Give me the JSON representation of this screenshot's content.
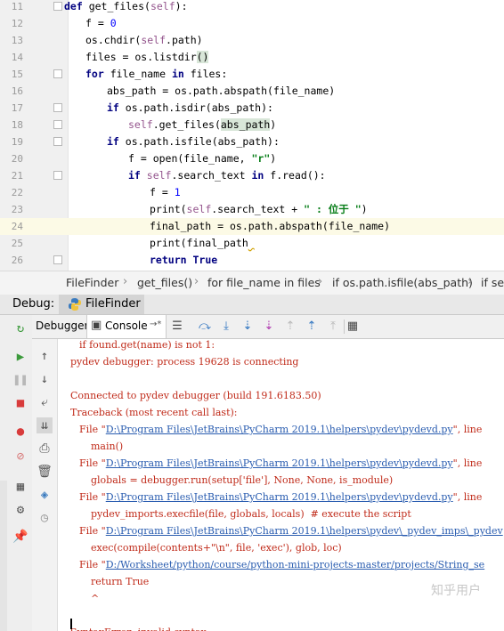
{
  "editor": {
    "lines": [
      {
        "n": "11",
        "indent": 0,
        "segs": [
          {
            "t": "def ",
            "c": "kw"
          },
          {
            "t": "get_files(",
            "c": ""
          },
          {
            "t": "self",
            "c": "sf"
          },
          {
            "t": "):",
            "c": ""
          }
        ],
        "fold": true,
        "clip": true
      },
      {
        "n": "12",
        "indent": 1,
        "segs": [
          {
            "t": "f = ",
            "c": ""
          },
          {
            "t": "0",
            "c": "nm"
          }
        ]
      },
      {
        "n": "13",
        "indent": 1,
        "segs": [
          {
            "t": "os.chdir(",
            "c": ""
          },
          {
            "t": "self",
            "c": "sf"
          },
          {
            "t": ".path)",
            "c": ""
          }
        ]
      },
      {
        "n": "14",
        "indent": 1,
        "segs": [
          {
            "t": "files = os.listdir",
            "c": ""
          },
          {
            "t": "()",
            "c": "mk"
          }
        ]
      },
      {
        "n": "15",
        "indent": 1,
        "segs": [
          {
            "t": "for ",
            "c": "kw"
          },
          {
            "t": "file_name ",
            "c": ""
          },
          {
            "t": "in ",
            "c": "kw"
          },
          {
            "t": "files:",
            "c": ""
          }
        ],
        "fold": true
      },
      {
        "n": "16",
        "indent": 2,
        "segs": [
          {
            "t": "abs_path = os.path.abspath(file_name)",
            "c": ""
          }
        ]
      },
      {
        "n": "17",
        "indent": 2,
        "segs": [
          {
            "t": "if ",
            "c": "kw"
          },
          {
            "t": "os.path.isdir(abs_path):",
            "c": ""
          }
        ],
        "fold": true
      },
      {
        "n": "18",
        "indent": 3,
        "segs": [
          {
            "t": "self",
            "c": "sf"
          },
          {
            "t": ".get_files(",
            "c": ""
          },
          {
            "t": "abs_path",
            "c": "mk"
          },
          {
            "t": ")",
            "c": ""
          }
        ],
        "fold": true
      },
      {
        "n": "19",
        "indent": 2,
        "segs": [
          {
            "t": "if ",
            "c": "kw"
          },
          {
            "t": "os.path.isfile(abs_path):",
            "c": ""
          }
        ],
        "fold": true
      },
      {
        "n": "20",
        "indent": 3,
        "segs": [
          {
            "t": "f = open(file_name, ",
            "c": ""
          },
          {
            "t": "\"r\"",
            "c": "st"
          },
          {
            "t": ")",
            "c": ""
          }
        ]
      },
      {
        "n": "21",
        "indent": 3,
        "segs": [
          {
            "t": "if ",
            "c": "kw"
          },
          {
            "t": "self",
            "c": "sf"
          },
          {
            "t": ".search_text ",
            "c": ""
          },
          {
            "t": "in ",
            "c": "kw"
          },
          {
            "t": "f.read():",
            "c": ""
          }
        ],
        "fold": true
      },
      {
        "n": "22",
        "indent": 4,
        "segs": [
          {
            "t": "f = ",
            "c": ""
          },
          {
            "t": "1",
            "c": "nm"
          }
        ]
      },
      {
        "n": "23",
        "indent": 4,
        "segs": [
          {
            "t": "print(",
            "c": ""
          },
          {
            "t": "self",
            "c": "sf"
          },
          {
            "t": ".search_text + ",
            "c": ""
          },
          {
            "t": "\" : 位于 \"",
            "c": "st"
          },
          {
            "t": ")",
            "c": ""
          }
        ]
      },
      {
        "n": "24",
        "indent": 4,
        "segs": [
          {
            "t": "final_path = os.path.abspath(file_name)",
            "c": ""
          }
        ],
        "hl": true
      },
      {
        "n": "25",
        "indent": 4,
        "segs": [
          {
            "t": "print(final_path",
            "c": ""
          },
          {
            "t": " ",
            "c": "ul"
          }
        ]
      },
      {
        "n": "26",
        "indent": 4,
        "segs": [
          {
            "t": "return ",
            "c": "kw"
          },
          {
            "t": "True",
            "c": "kw"
          }
        ],
        "fold": true
      }
    ]
  },
  "breadcrumb": {
    "items": [
      "FileFinder",
      "get_files()",
      "for file_name in files",
      "if os.path.isfile(abs_path)",
      "if sel"
    ]
  },
  "debug": {
    "label": "Debug:",
    "tab_label": "FileFinder",
    "debugger_tab": "Debugger",
    "console_tab": "Console",
    "console_arrow": "→*"
  },
  "console": {
    "lines": [
      {
        "cls": "ind",
        "text": "if found.get(name) is not 1:"
      },
      {
        "cls": "",
        "text": "pydev debugger: process 19628 is connecting"
      },
      {
        "cls": "",
        "text": ""
      },
      {
        "cls": "",
        "text": "Connected to pydev debugger (build 191.6183.50)"
      },
      {
        "cls": "",
        "text": "Traceback (most recent call last):"
      },
      {
        "cls": "ind",
        "pre": "File \"",
        "link": "D:\\Program Files\\JetBrains\\PyCharm 2019.1\\helpers\\pydev\\pydevd.py",
        "post": "\", line"
      },
      {
        "cls": "ind2",
        "text": "main()"
      },
      {
        "cls": "ind",
        "pre": "File \"",
        "link": "D:\\Program Files\\JetBrains\\PyCharm 2019.1\\helpers\\pydev\\pydevd.py",
        "post": "\", line"
      },
      {
        "cls": "ind2",
        "text": "globals = debugger.run(setup['file'], None, None, is_module)"
      },
      {
        "cls": "ind",
        "pre": "File \"",
        "link": "D:\\Program Files\\JetBrains\\PyCharm 2019.1\\helpers\\pydev\\pydevd.py",
        "post": "\", line"
      },
      {
        "cls": "ind2",
        "text": "pydev_imports.execfile(file, globals, locals)  # execute the script"
      },
      {
        "cls": "ind",
        "pre": "File \"",
        "link": "D:\\Program Files\\JetBrains\\PyCharm 2019.1\\helpers\\pydev\\_pydev_imps\\_pydev",
        "post": ""
      },
      {
        "cls": "ind2",
        "text": "exec(compile(contents+\"\\n\", file, 'exec'), glob, loc)"
      },
      {
        "cls": "ind",
        "pre": "File \"",
        "link": "D:/Worksheet/python/course/python-mini-projects-master/projects/String_se",
        "post": ""
      },
      {
        "cls": "ind2",
        "text": "return True"
      },
      {
        "cls": "ind2",
        "text": "^"
      },
      {
        "cls": "",
        "text": ""
      },
      {
        "cls": "",
        "text": "SyntaxError: invalid syntax"
      }
    ]
  },
  "watermark": "知乎用户",
  "colors": {
    "keyword": "#000080",
    "self": "#94558d",
    "string": "#067d17",
    "number": "#0000ff",
    "console_text": "#c02b1a",
    "link": "#2a5db0"
  }
}
